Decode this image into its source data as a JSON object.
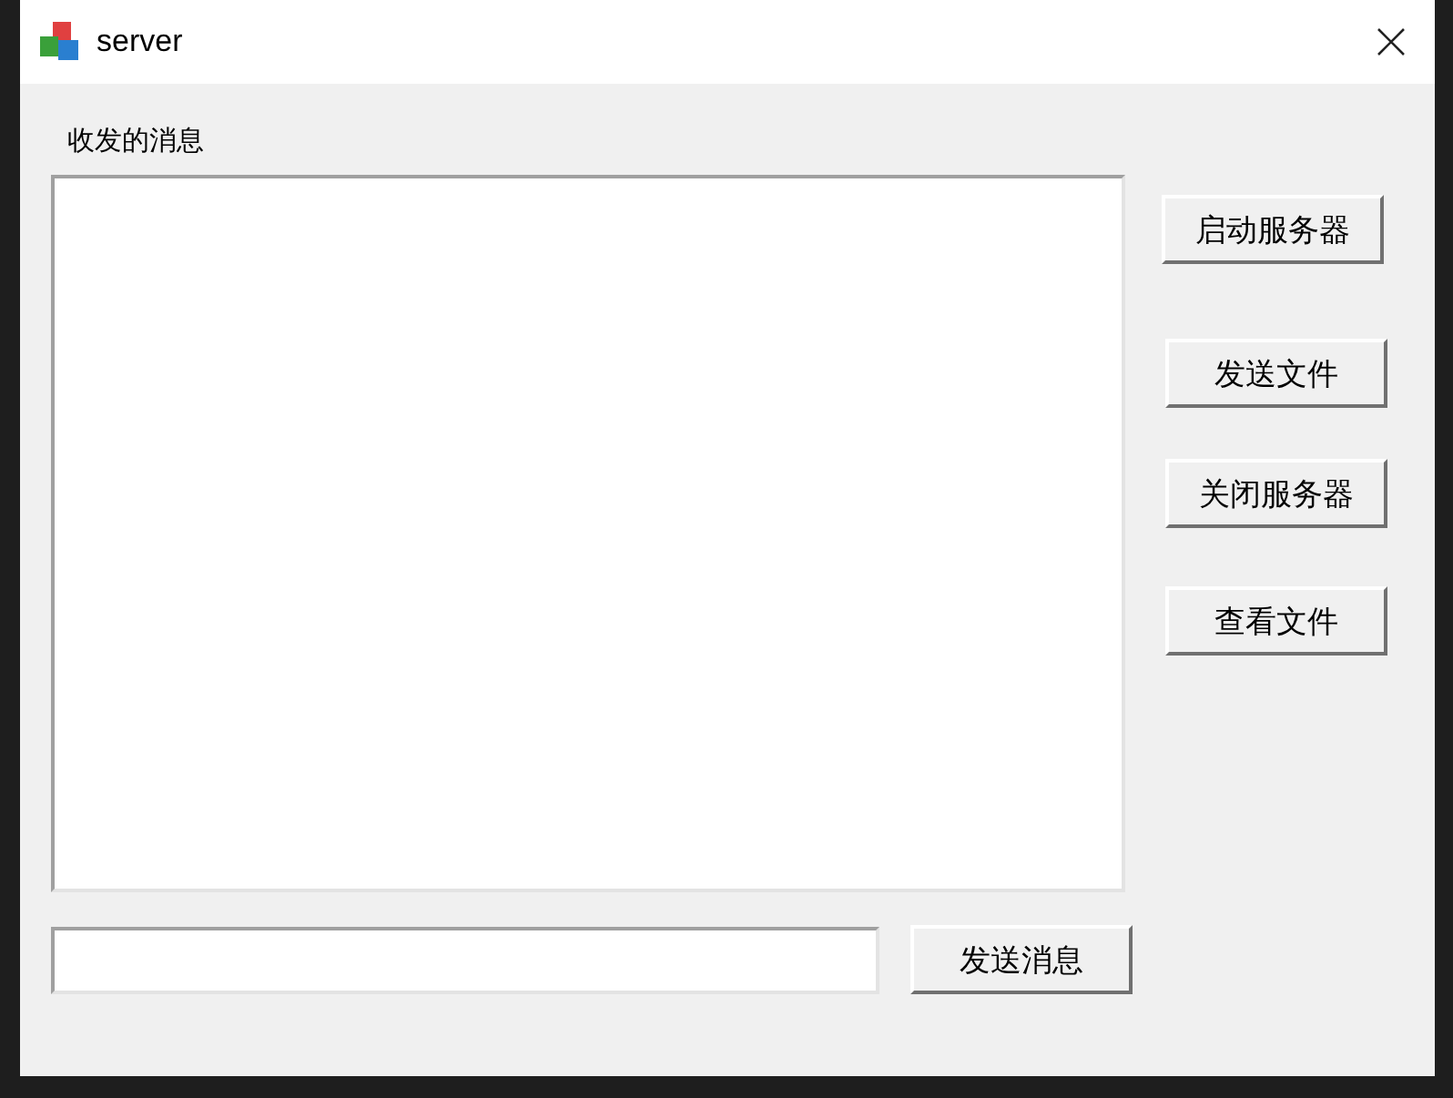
{
  "window": {
    "title": "server"
  },
  "messages": {
    "label": "收发的消息"
  },
  "side_buttons": [
    "启动服务器",
    "发送文件",
    "关闭服务器",
    "查看文件"
  ],
  "send_button": "发送消息"
}
